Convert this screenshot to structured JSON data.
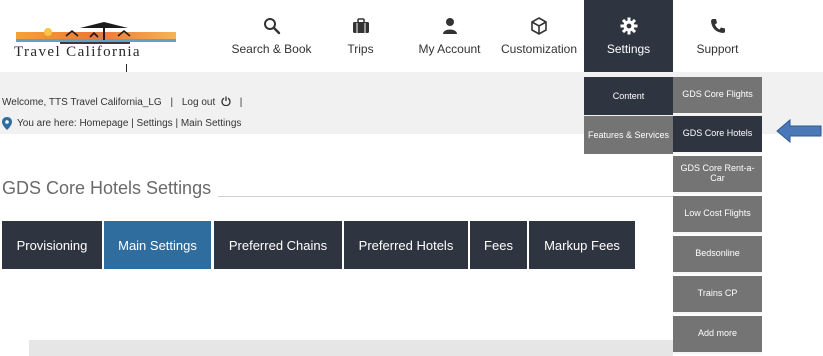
{
  "brand": {
    "logo_text": "Travel California"
  },
  "nav": {
    "items": [
      {
        "label": "Search & Book",
        "icon": "search-icon"
      },
      {
        "label": "Trips",
        "icon": "suitcase-icon"
      },
      {
        "label": "My Account",
        "icon": "user-icon"
      },
      {
        "label": "Customization",
        "icon": "box-icon"
      },
      {
        "label": "Settings",
        "icon": "gear-icon",
        "active": true
      },
      {
        "label": "Support",
        "icon": "phone-icon"
      }
    ]
  },
  "header": {
    "welcome": "Welcome, TTS Travel California_LG",
    "separator": "|",
    "logout": "Log out",
    "trailing_separator": "|",
    "you_are_here": "You are here: Homepage | Settings | Main Settings"
  },
  "settings_menu": {
    "left": [
      "Content",
      "Features & Services"
    ],
    "right": [
      "GDS Core Flights",
      "GDS Core Hotels",
      "GDS Core Rent-a-Car",
      "Low Cost Flights",
      "Bedsonline",
      "Trains CP",
      "Add more"
    ],
    "highlighted": "GDS Core Hotels"
  },
  "page": {
    "title": "GDS Core Hotels Settings"
  },
  "tabs": [
    {
      "label": "Provisioning"
    },
    {
      "label": "Main Settings",
      "active": true
    },
    {
      "label": "Preferred Chains"
    },
    {
      "label": "Preferred Hotels"
    },
    {
      "label": "Fees"
    },
    {
      "label": "Markup Fees"
    }
  ],
  "colors": {
    "nav_active_bg": "#2f3540",
    "accent_blue": "#2f6d9e",
    "menu_grey": "#747474",
    "arrow_blue": "#4a78b8"
  }
}
